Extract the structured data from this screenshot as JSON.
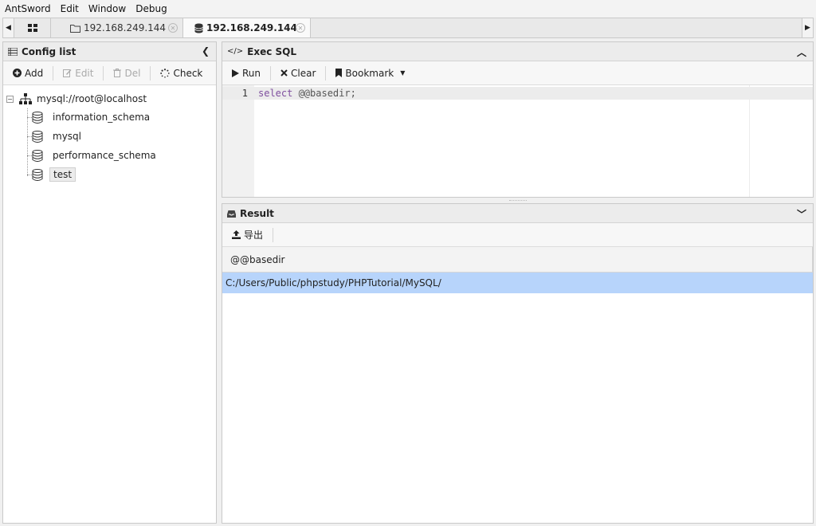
{
  "menu": [
    "AntSword",
    "Edit",
    "Window",
    "Debug"
  ],
  "tabs": {
    "tab1_label": "192.168.249.144",
    "tab2_label": "192.168.249.144"
  },
  "config": {
    "title": "Config list",
    "toolbar": {
      "add": "Add",
      "edit": "Edit",
      "del": "Del",
      "check": "Check"
    },
    "tree": {
      "root": "mysql://root@localhost",
      "databases": [
        "information_schema",
        "mysql",
        "performance_schema",
        "test"
      ],
      "selected": "test"
    }
  },
  "exec": {
    "title": "Exec SQL",
    "toolbar": {
      "run": "Run",
      "clear": "Clear",
      "bookmark": "Bookmark"
    },
    "editor": {
      "line_number": "1",
      "keyword": "select",
      "rest": " @@basedir;"
    }
  },
  "result": {
    "title": "Result",
    "export_label": "导出",
    "columns": [
      "@@basedir"
    ],
    "rows": [
      [
        "C:/Users/Public/phpstudy/PHPTutorial/MySQL/"
      ]
    ]
  },
  "colors": {
    "accent_selection": "#b7d4fb",
    "keyword": "#7f4f9f"
  }
}
